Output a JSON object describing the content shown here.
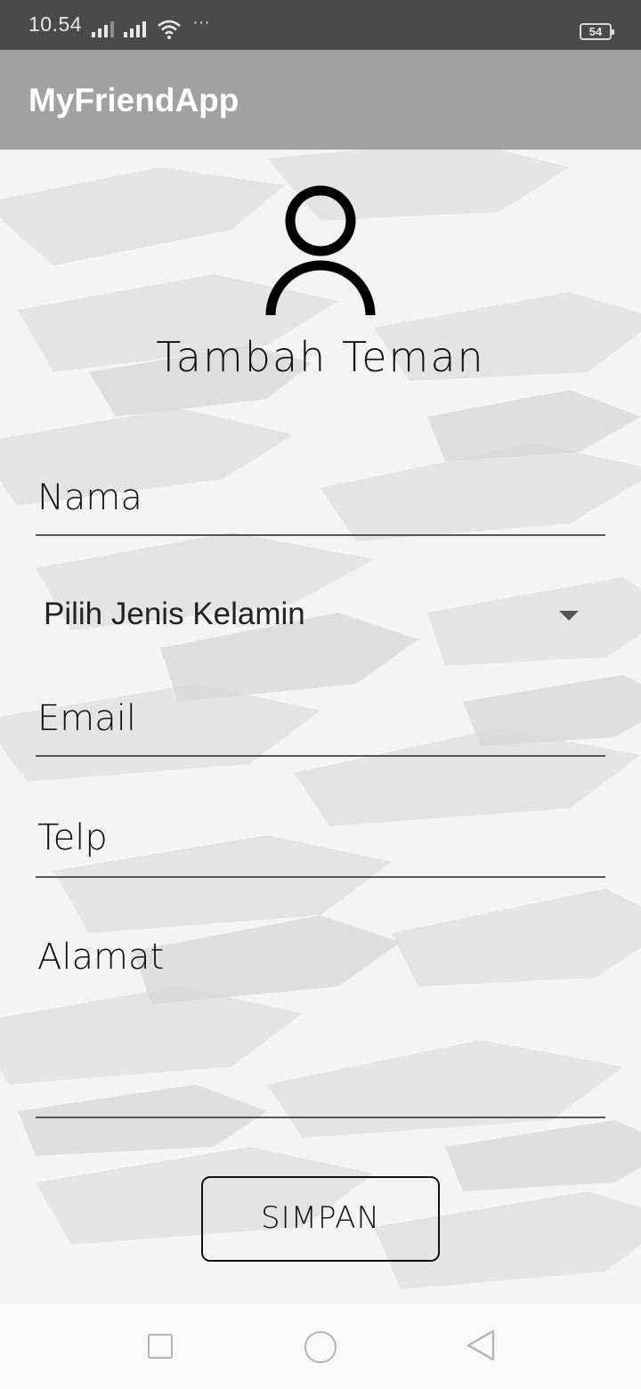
{
  "status_bar": {
    "time": "10.54",
    "more": "···",
    "battery": "54"
  },
  "app_bar": {
    "title": "MyFriendApp"
  },
  "form": {
    "heading": "Tambah Teman",
    "nama_hint": "Nama",
    "gender_spinner": "Pilih Jenis Kelamin",
    "email_hint": "Email",
    "telp_hint": "Telp",
    "alamat_hint": "Alamat",
    "save_label": "SIMPAN"
  },
  "icons": {
    "avatar": "person-outline-icon",
    "dropdown": "triangle-down-icon",
    "nav_recent": "square-icon",
    "nav_home": "circle-icon",
    "nav_back": "triangle-left-icon"
  },
  "colors": {
    "status_bar": "#4a4a4a",
    "app_bar": "#a1a1a1",
    "background": "#f4f4f4",
    "text": "#111111"
  }
}
